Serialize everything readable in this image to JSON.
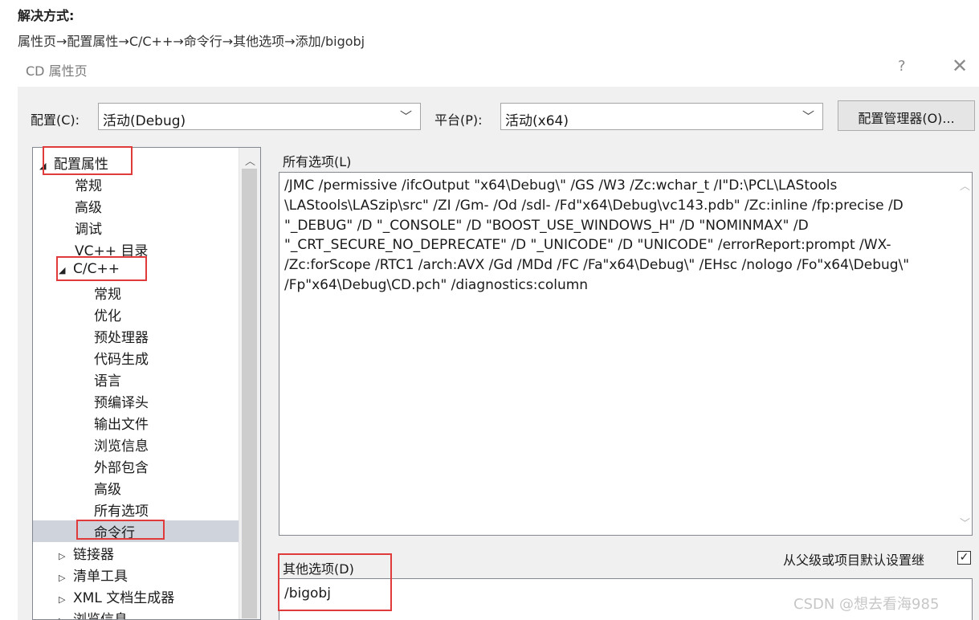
{
  "article": {
    "heading": "解决方式:",
    "path": "属性页→配置属性→C/C++→命令行→其他选项→添加/bigobj"
  },
  "dialog": {
    "title": "CD 属性页",
    "help_glyph": "?",
    "close_glyph": "✕"
  },
  "toolbar": {
    "config_label": "配置(C):",
    "config_value": "活动(Debug)",
    "platform_label": "平台(P):",
    "platform_value": "活动(x64)",
    "config_manager_button": "配置管理器(O)..."
  },
  "tree": {
    "items": [
      {
        "label": "配置属性",
        "caret": "◢"
      },
      {
        "label": "常规"
      },
      {
        "label": "高级"
      },
      {
        "label": "调试"
      },
      {
        "label": "VC++ 目录"
      },
      {
        "label": "C/C++",
        "caret": "◢"
      },
      {
        "label": "常规"
      },
      {
        "label": "优化"
      },
      {
        "label": "预处理器"
      },
      {
        "label": "代码生成"
      },
      {
        "label": "语言"
      },
      {
        "label": "预编译头"
      },
      {
        "label": "输出文件"
      },
      {
        "label": "浏览信息"
      },
      {
        "label": "外部包含"
      },
      {
        "label": "高级"
      },
      {
        "label": "所有选项"
      },
      {
        "label": "命令行",
        "selected": true
      },
      {
        "label": "链接器",
        "caret": "▷"
      },
      {
        "label": "清单工具",
        "caret": "▷"
      },
      {
        "label": "XML 文档生成器",
        "caret": "▷"
      },
      {
        "label": "浏览信息",
        "caret": "▷"
      }
    ]
  },
  "all_options": {
    "label": "所有选项(L)",
    "text": "/JMC /permissive /ifcOutput \"x64\\Debug\\\" /GS /W3 /Zc:wchar_t /I\"D:\\PCL\\LAStools \\LAStools\\LASzip\\src\" /ZI /Gm- /Od /sdl- /Fd\"x64\\Debug\\vc143.pdb\" /Zc:inline /fp:precise /D \"_DEBUG\" /D \"_CONSOLE\" /D \"BOOST_USE_WINDOWS_H\" /D \"NOMINMAX\" /D \"_CRT_SECURE_NO_DEPRECATE\" /D \"_UNICODE\" /D \"UNICODE\" /errorReport:prompt /WX- /Zc:forScope /RTC1 /arch:AVX /Gd /MDd /FC /Fa\"x64\\Debug\\\" /EHsc /nologo /Fo\"x64\\Debug\\\" /Fp\"x64\\Debug\\CD.pch\" /diagnostics:column"
  },
  "other_options": {
    "label": "其他选项(D)",
    "value": "/bigobj",
    "inherit_label": "从父级或项目默认设置继",
    "inherit_checked": true
  },
  "watermark": "CSDN @想去看海985",
  "colors": {
    "highlight_red": "#e13a3a",
    "selection_bg": "#cfd3dc",
    "dialog_bg": "#f0f0f0"
  }
}
